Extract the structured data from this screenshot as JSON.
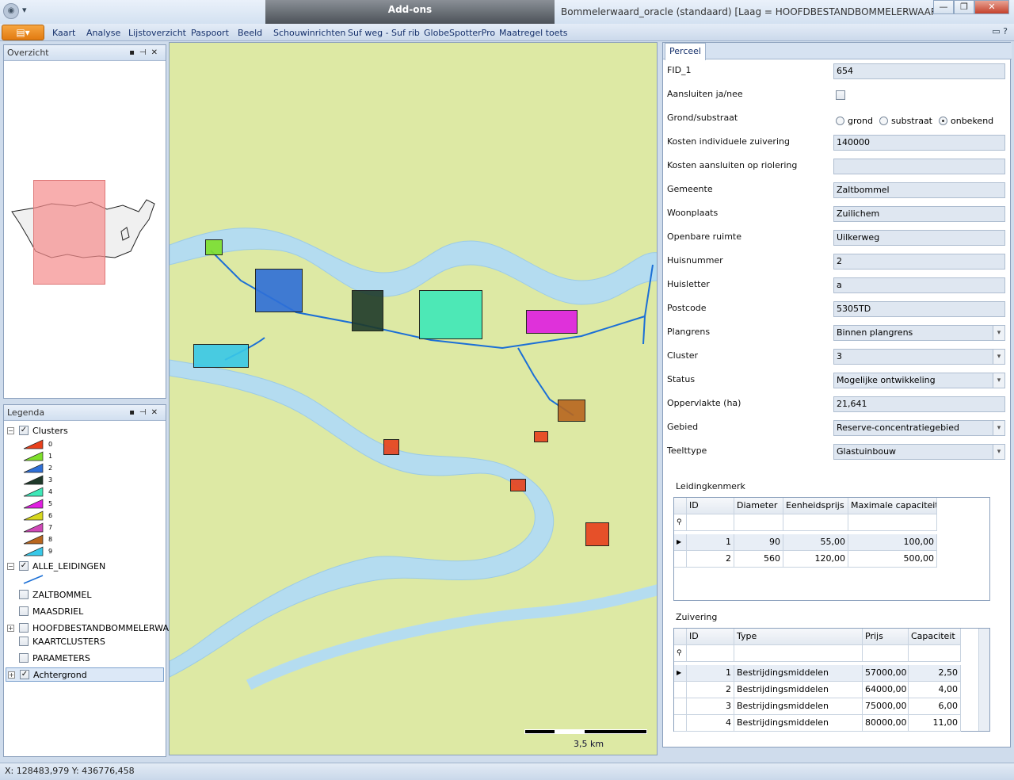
{
  "titlebar": {
    "app_title": "Bommelerwaard_oracle (standaard) [Laag = HOOFDBESTANDBOMMELERWAARD : ID = ...",
    "addons_label": "Add-ons",
    "minimize": "—",
    "restore": "❐",
    "close": "✕"
  },
  "ribbon": {
    "app_button": "▤▾",
    "tabs": [
      "Kaart",
      "Analyse",
      "Lijstoverzicht",
      "Paspoort",
      "Beeld",
      "Schouwinrichten",
      "Suf weg - Suf rib",
      "GlobeSpotterPro",
      "Maatregel toets"
    ],
    "help": "▭ ?"
  },
  "overview": {
    "title": "Overzicht"
  },
  "legend": {
    "title": "Legenda",
    "clusters_label": "Clusters",
    "clusters": [
      {
        "id": "0",
        "color": "#e8401c"
      },
      {
        "id": "1",
        "color": "#7ee02a"
      },
      {
        "id": "2",
        "color": "#2e6fd8"
      },
      {
        "id": "3",
        "color": "#1f3a2a"
      },
      {
        "id": "4",
        "color": "#3ee8b8"
      },
      {
        "id": "5",
        "color": "#e01ee0"
      },
      {
        "id": "6",
        "color": "#d8d81e"
      },
      {
        "id": "7",
        "color": "#d048b8"
      },
      {
        "id": "8",
        "color": "#b8661e"
      },
      {
        "id": "9",
        "color": "#38c8e8"
      }
    ],
    "layers": [
      {
        "label": "ALLE_LEIDINGEN",
        "checked": "✓"
      },
      {
        "label": "ZALTBOMMEL",
        "checked": ""
      },
      {
        "label": "MAASDRIEL",
        "checked": ""
      },
      {
        "label": "HOOFDBESTANDBOMMELERWAARD",
        "checked": ""
      },
      {
        "label": "KAARTCLUSTERS",
        "checked": ""
      },
      {
        "label": "PARAMETERS",
        "checked": ""
      },
      {
        "label": "Achtergrond",
        "checked": "✓"
      }
    ],
    "clusters_checked": "✓"
  },
  "map": {
    "scale_label": "3,5 km"
  },
  "detail": {
    "tab": "Perceel",
    "fields": [
      {
        "label": "FID_1",
        "value": "654",
        "type": "text"
      },
      {
        "label": "Aansluiten ja/nee",
        "value": "",
        "type": "checkbox"
      },
      {
        "label": "Grond/substraat",
        "value": "",
        "type": "radio"
      },
      {
        "label": "Kosten individuele zuivering",
        "value": "140000",
        "type": "text"
      },
      {
        "label": "Kosten aansluiten op riolering",
        "value": "",
        "type": "text"
      },
      {
        "label": "Gemeente",
        "value": "Zaltbommel",
        "type": "text"
      },
      {
        "label": "Woonplaats",
        "value": "Zuilichem",
        "type": "text"
      },
      {
        "label": "Openbare ruimte",
        "value": "Uilkerweg",
        "type": "text"
      },
      {
        "label": "Huisnummer",
        "value": "2",
        "type": "text"
      },
      {
        "label": "Huisletter",
        "value": "a",
        "type": "text"
      },
      {
        "label": "Postcode",
        "value": "5305TD",
        "type": "text"
      },
      {
        "label": "Plangrens",
        "value": "Binnen plangrens",
        "type": "combo"
      },
      {
        "label": "Cluster",
        "value": "3",
        "type": "combo"
      },
      {
        "label": "Status",
        "value": "Mogelijke ontwikkeling",
        "type": "combo"
      },
      {
        "label": "Oppervlakte (ha)",
        "value": "21,641",
        "type": "text"
      },
      {
        "label": "Gebied",
        "value": "Reserve-concentratiegebied",
        "type": "combo"
      },
      {
        "label": "Teelttype",
        "value": "Glastuinbouw",
        "type": "combo"
      }
    ],
    "radio_options": [
      "grond",
      "substraat",
      "onbekend"
    ],
    "radio_selected": "onbekend",
    "leiding": {
      "title": "Leidingkenmerk",
      "columns": [
        "ID",
        "Diameter",
        "Eenheidsprijs",
        "Maximale capaciteit"
      ],
      "rows": [
        [
          "1",
          "90",
          "55,00",
          "100,00"
        ],
        [
          "2",
          "560",
          "120,00",
          "500,00"
        ]
      ]
    },
    "zuivering": {
      "title": "Zuivering",
      "columns": [
        "ID",
        "Type",
        "Prijs",
        "Capaciteit"
      ],
      "rows": [
        [
          "1",
          "Bestrijdingsmiddelen",
          "57000,00",
          "2,50"
        ],
        [
          "2",
          "Bestrijdingsmiddelen",
          "64000,00",
          "4,00"
        ],
        [
          "3",
          "Bestrijdingsmiddelen",
          "75000,00",
          "6,00"
        ],
        [
          "4",
          "Bestrijdingsmiddelen",
          "80000,00",
          "11,00"
        ]
      ]
    }
  },
  "status": {
    "coords": "X: 128483,979 Y: 436776,458"
  }
}
